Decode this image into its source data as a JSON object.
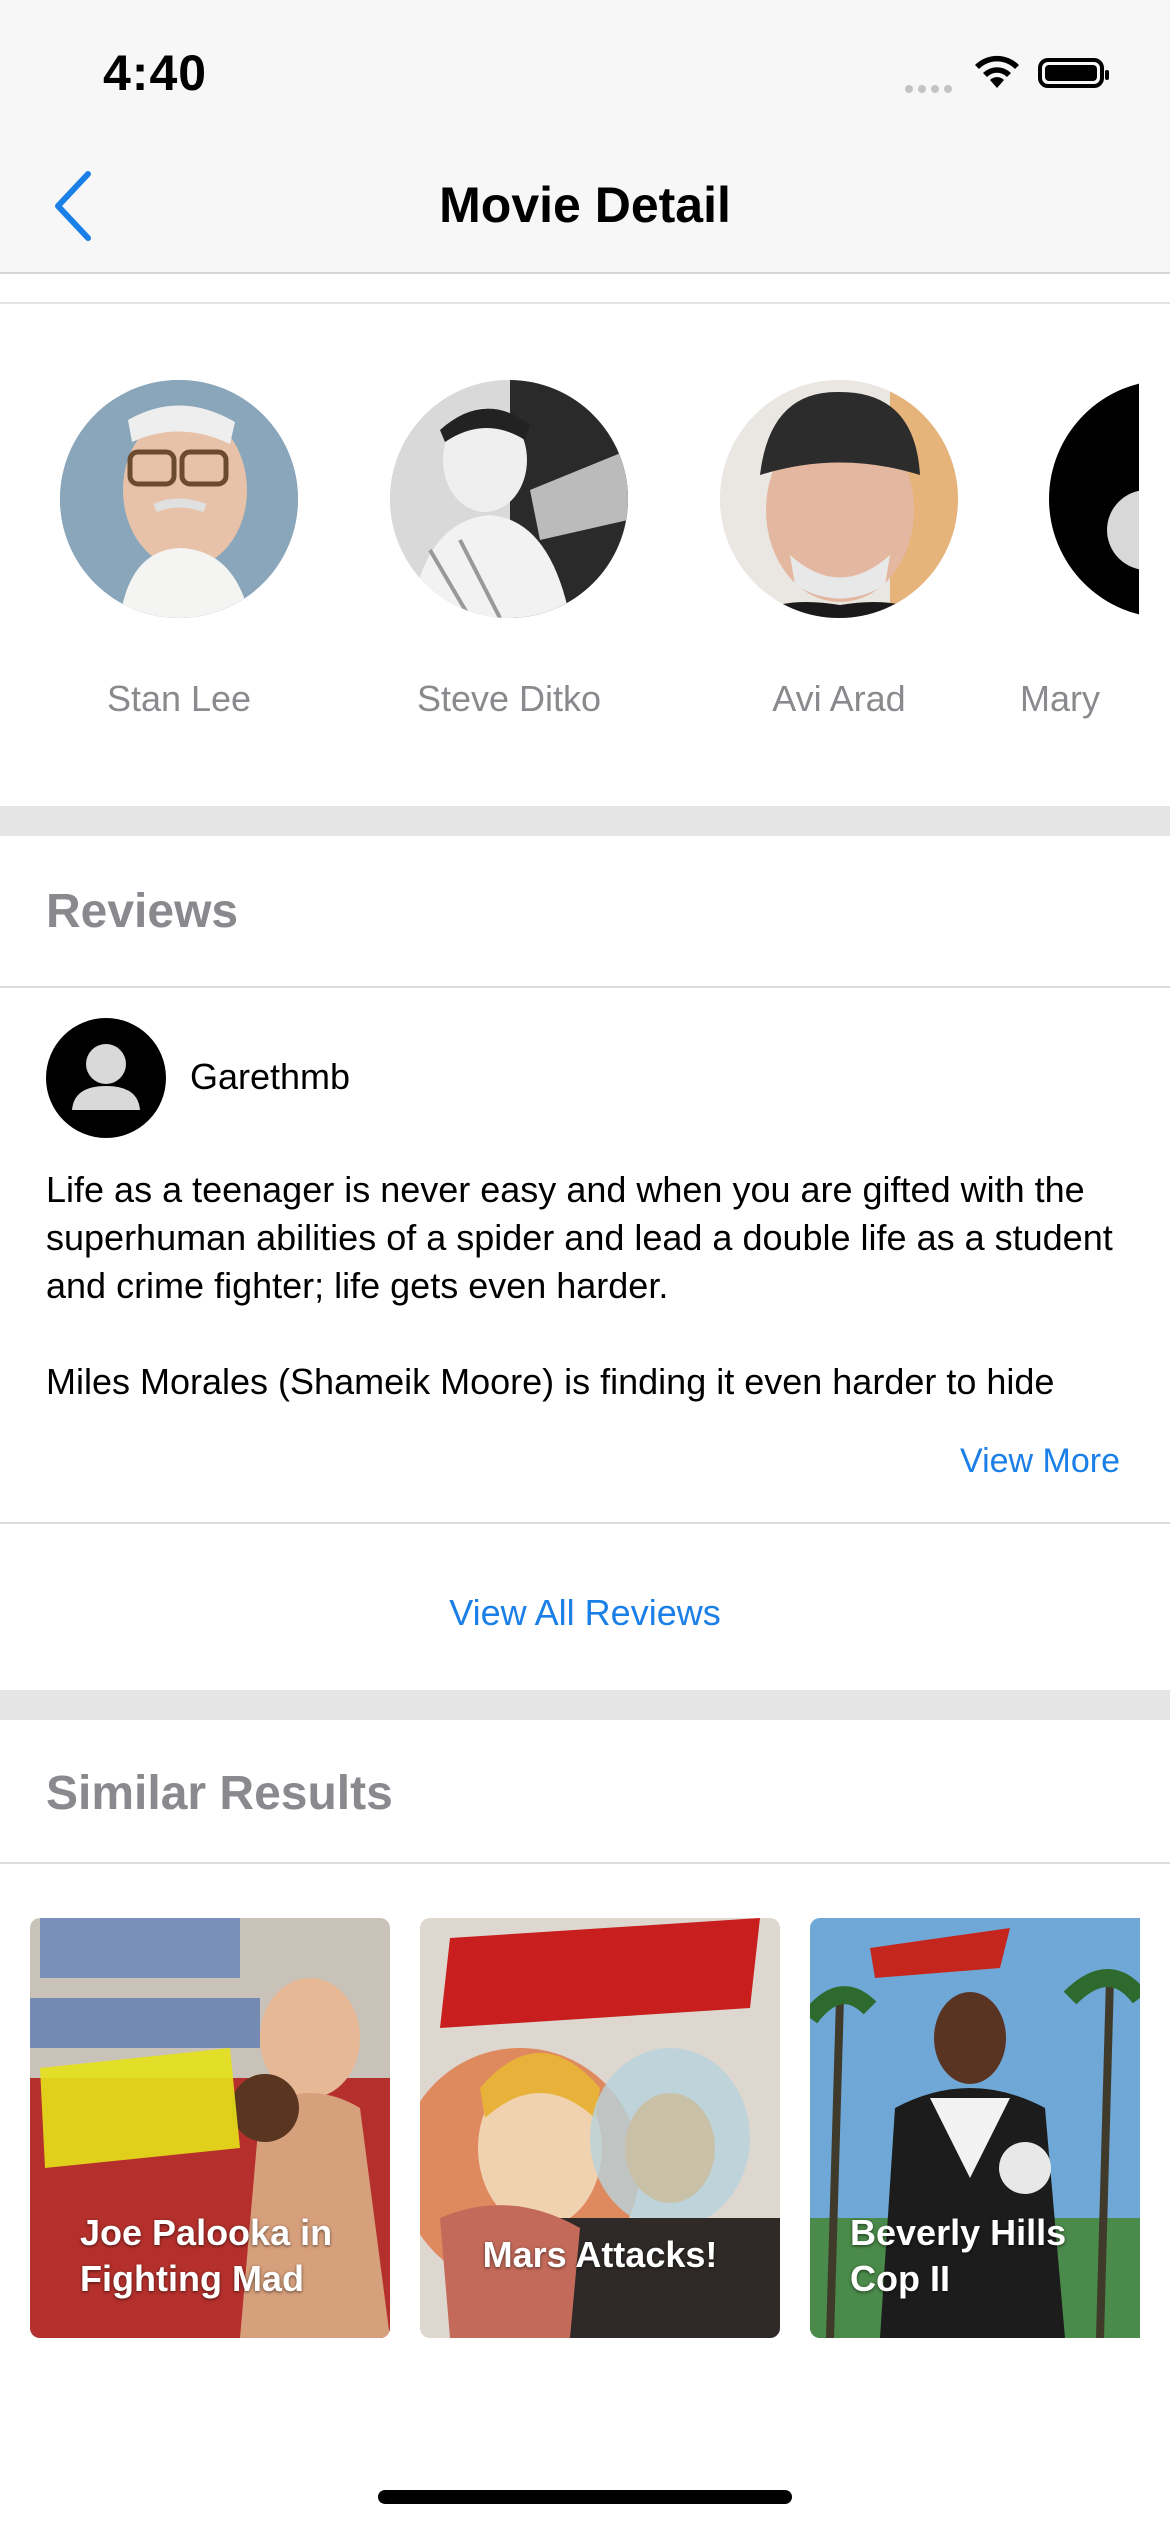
{
  "status_bar": {
    "time": "4:40"
  },
  "nav": {
    "title": "Movie Detail"
  },
  "cast": [
    {
      "name": "Stan Lee"
    },
    {
      "name": "Steve Ditko"
    },
    {
      "name": "Avi Arad"
    },
    {
      "name": "Mary"
    }
  ],
  "reviews": {
    "section_title": "Reviews",
    "items": [
      {
        "author": "Garethmb",
        "paragraph_1": "Life as a teenager is never easy and when you are gifted with the superhuman abilities of a spider and lead a double life as a student and crime fighter; life gets even harder.",
        "paragraph_2": "Miles Morales (Shameik Moore) is finding it even harder to hide"
      }
    ],
    "view_more": "View More",
    "view_all": "View All Reviews"
  },
  "similar": {
    "section_title": "Similar Results",
    "items": [
      {
        "title": "Joe Palooka in Fighting Mad"
      },
      {
        "title": "Mars Attacks!"
      },
      {
        "title": "Beverly Hills Cop II"
      }
    ]
  },
  "colors": {
    "accent": "#1a7fe6",
    "secondary_text": "#8a8a8e",
    "separator": "#e5e5e5"
  }
}
